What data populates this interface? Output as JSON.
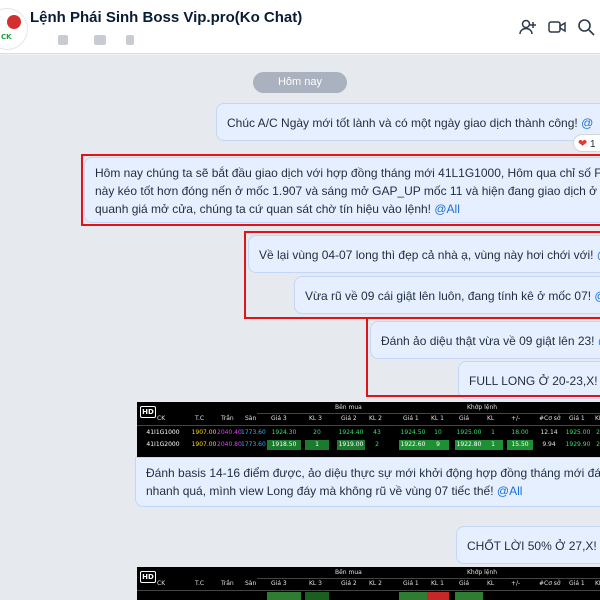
{
  "header": {
    "title": "Lệnh Phái Sinh Boss Vip.pro(Ko Chat)",
    "avatar_label": "CK"
  },
  "chat": {
    "date_label": "Hôm nay",
    "reaction": {
      "emoji": "❤",
      "count": "1"
    },
    "messages": [
      {
        "text": "Chúc A/C Ngày mới tốt lành và có một ngày giao dịch thành công! ",
        "mention": "@"
      },
      {
        "lines": [
          "Hôm nay chúng ta sẽ bắt đầu giao dịch với hợp đồng tháng mới 41L1G1000, Hôm qua chỉ số F2",
          "này kéo tốt hơn đóng nến ở mốc 1.907 và sáng mở GAP_UP mốc 11 và hiện đang giao dịch ở vù",
          "quanh giá mở cửa, chúng ta cứ quan sát chờ tín hiệu vào lệnh! "
        ],
        "mention": "@All"
      },
      {
        "text": "Về lại vùng 04-07 long thì đẹp cả nhà ạ, vùng này hơi chới với! ",
        "mention": "@"
      },
      {
        "text": "Vừa rũ về 09 cái giật lên luôn, đang tính kê ở mốc 07! ",
        "mention": "@"
      },
      {
        "text": "Đánh ảo diệu thật vừa về 09 giật lên 23! ",
        "mention": "@"
      },
      {
        "text": "FULL LONG Ở 20-23,X! ",
        "mention": "@"
      },
      {
        "lines": [
          "Đánh basis 14-16 điểm được, ảo diệu thực sự mới khởi động hợp đồng tháng mới đán",
          "nhanh quá, mình view Long đáy mà không rũ về vùng 07 tiếc thế! "
        ],
        "mention": "@All"
      },
      {
        "text": "CHỐT LỜI 50% Ở 27,X! ",
        "mention": "@"
      }
    ]
  },
  "board": {
    "hd": "HD",
    "group_headers": {
      "buy": "Bên mua",
      "match": "Khớp lệnh"
    },
    "columns": [
      "CK",
      "T.C",
      "Trần",
      "Sàn",
      "Giá 3",
      "KL 3",
      "Giá 2",
      "KL 2",
      "Giá 1",
      "KL 1",
      "Giá",
      "KL",
      "+/-",
      "#Cơ sở",
      "Giá 1",
      "KL 1"
    ],
    "rows": [
      {
        "symbol": "41I1G1000",
        "tc": "1907.00",
        "tran": "2040.40",
        "san": "1773.60",
        "g3": "1924.30",
        "kl3": "20",
        "g2": "1924.40",
        "kl2": "43",
        "g1": "1924.50",
        "kl1": "10",
        "gia": "1925.00",
        "kl": "1",
        "change": "18.00",
        "coso": "12.14",
        "sg1": "1925.00",
        "skl1": "2"
      },
      {
        "symbol": "41I1G2000",
        "tc": "1907.00",
        "tran": "2040.80",
        "san": "1773.60",
        "g3": "1918.50",
        "kl3": "1",
        "g2": "1919.00",
        "kl2": "2",
        "g1": "1922.60",
        "kl1": "9",
        "gia": "1922.80",
        "kl": "1",
        "change": "15.50",
        "coso": "9.94",
        "sg1": "1929.90",
        "skl1": "2"
      }
    ]
  },
  "colors": {
    "bubble": "#e5efff",
    "highlight_border": "#e0131a",
    "mention": "#1a6fe0",
    "ceiling": "#e040fb",
    "floor": "#29b6f6",
    "reference": "#ffd600",
    "up": "#2ee56b"
  },
  "icons": [
    "add-member-icon",
    "video-call-icon",
    "search-icon",
    "more-icon"
  ]
}
